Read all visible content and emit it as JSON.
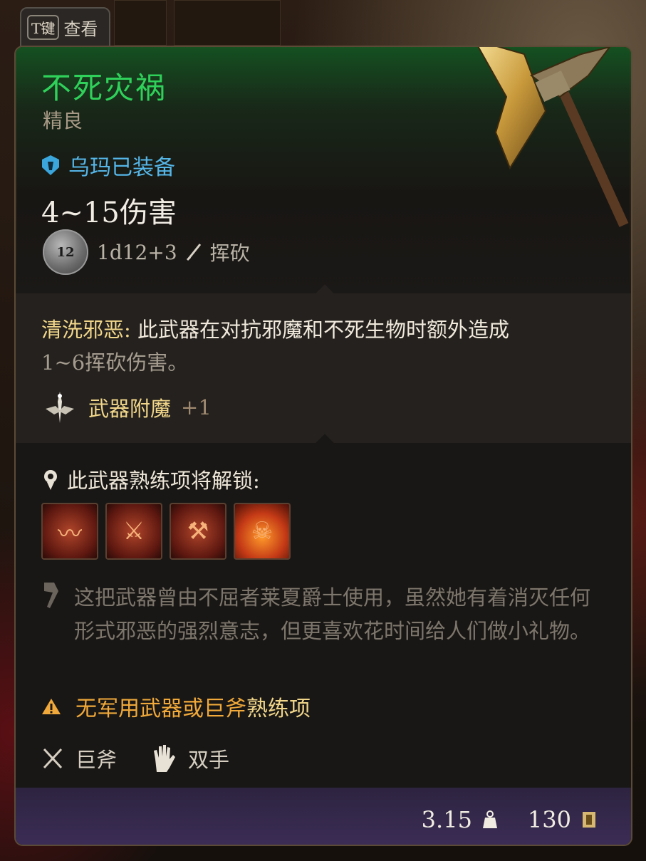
{
  "hint": {
    "key": "T键",
    "label": "查看"
  },
  "item": {
    "name": "不死灾祸",
    "rarity": "精良",
    "equipped_by": "乌玛已装备",
    "damage": "4~15伤害",
    "dice_face": "12",
    "dice_roll": "1d12+3",
    "damage_type": "挥砍"
  },
  "passive": {
    "name": "清洗邪恶:",
    "text_line1": " 此武器在对抗邪魔和不死生物时额外造成",
    "text_line2": "1~6挥砍伤害。"
  },
  "enchant": {
    "label": "武器附魔",
    "value": "+1"
  },
  "proficiency": {
    "label": "此武器熟练项将解锁:",
    "skills": [
      "skill-1",
      "skill-2",
      "skill-3",
      "skill-4"
    ]
  },
  "lore": "这把武器曾由不屈者莱夏爵士使用，虽然她有着消灭任何形式邪恶的强烈意志，但更喜欢花时间给人们做小礼物。",
  "warning": {
    "part1": "无军用武器或",
    "part2": "巨斧",
    "part3": "熟练项"
  },
  "properties": {
    "type": "巨斧",
    "handedness": "双手"
  },
  "footer": {
    "weight": "3.15",
    "value": "130"
  },
  "colors": {
    "name": "#2fd15a",
    "equipped": "#55b6e8",
    "warning": "#f0a93a",
    "gold": "#f1d68a"
  }
}
